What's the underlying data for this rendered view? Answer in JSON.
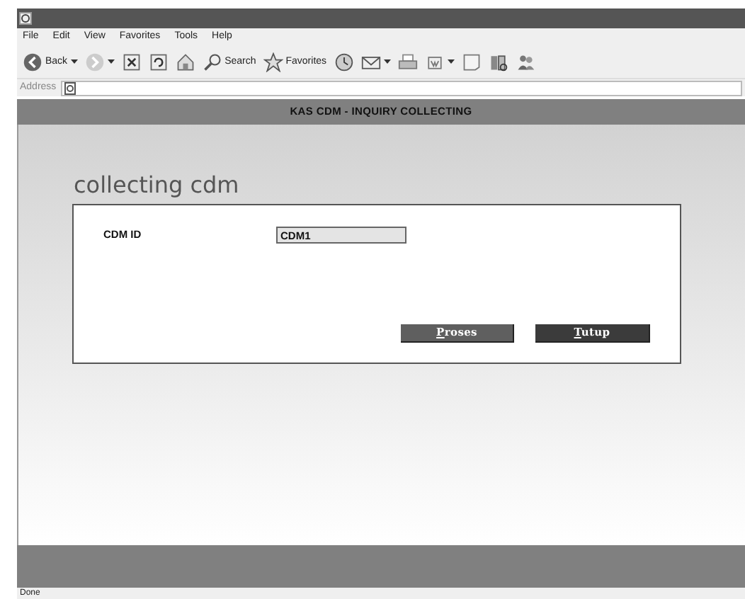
{
  "browser": {
    "menu": [
      "File",
      "Edit",
      "View",
      "Favorites",
      "Tools",
      "Help"
    ],
    "toolbar": [
      {
        "kind": "back",
        "label": "Back",
        "dropdown": true
      },
      {
        "kind": "forward",
        "dropdown": true
      },
      {
        "kind": "stop"
      },
      {
        "kind": "refresh"
      },
      {
        "kind": "home"
      },
      {
        "kind": "search",
        "label": "Search"
      },
      {
        "kind": "favorites",
        "label": "Favorites"
      },
      {
        "kind": "history"
      },
      {
        "kind": "mail",
        "dropdown": true
      },
      {
        "kind": "print"
      },
      {
        "kind": "edit",
        "dropdown": true
      },
      {
        "kind": "discuss"
      },
      {
        "kind": "research"
      },
      {
        "kind": "messenger"
      }
    ],
    "address_label": "Address"
  },
  "page": {
    "header": "KAS CDM - INQUIRY COLLECTING",
    "heading": "collecting cdm",
    "fields": [
      {
        "label": "CDM ID",
        "value": "CDM1"
      }
    ],
    "buttons": [
      {
        "label": "Proses",
        "kind": "primary"
      },
      {
        "label": "Tutup",
        "kind": "dark"
      }
    ]
  },
  "status_bar": "Done"
}
